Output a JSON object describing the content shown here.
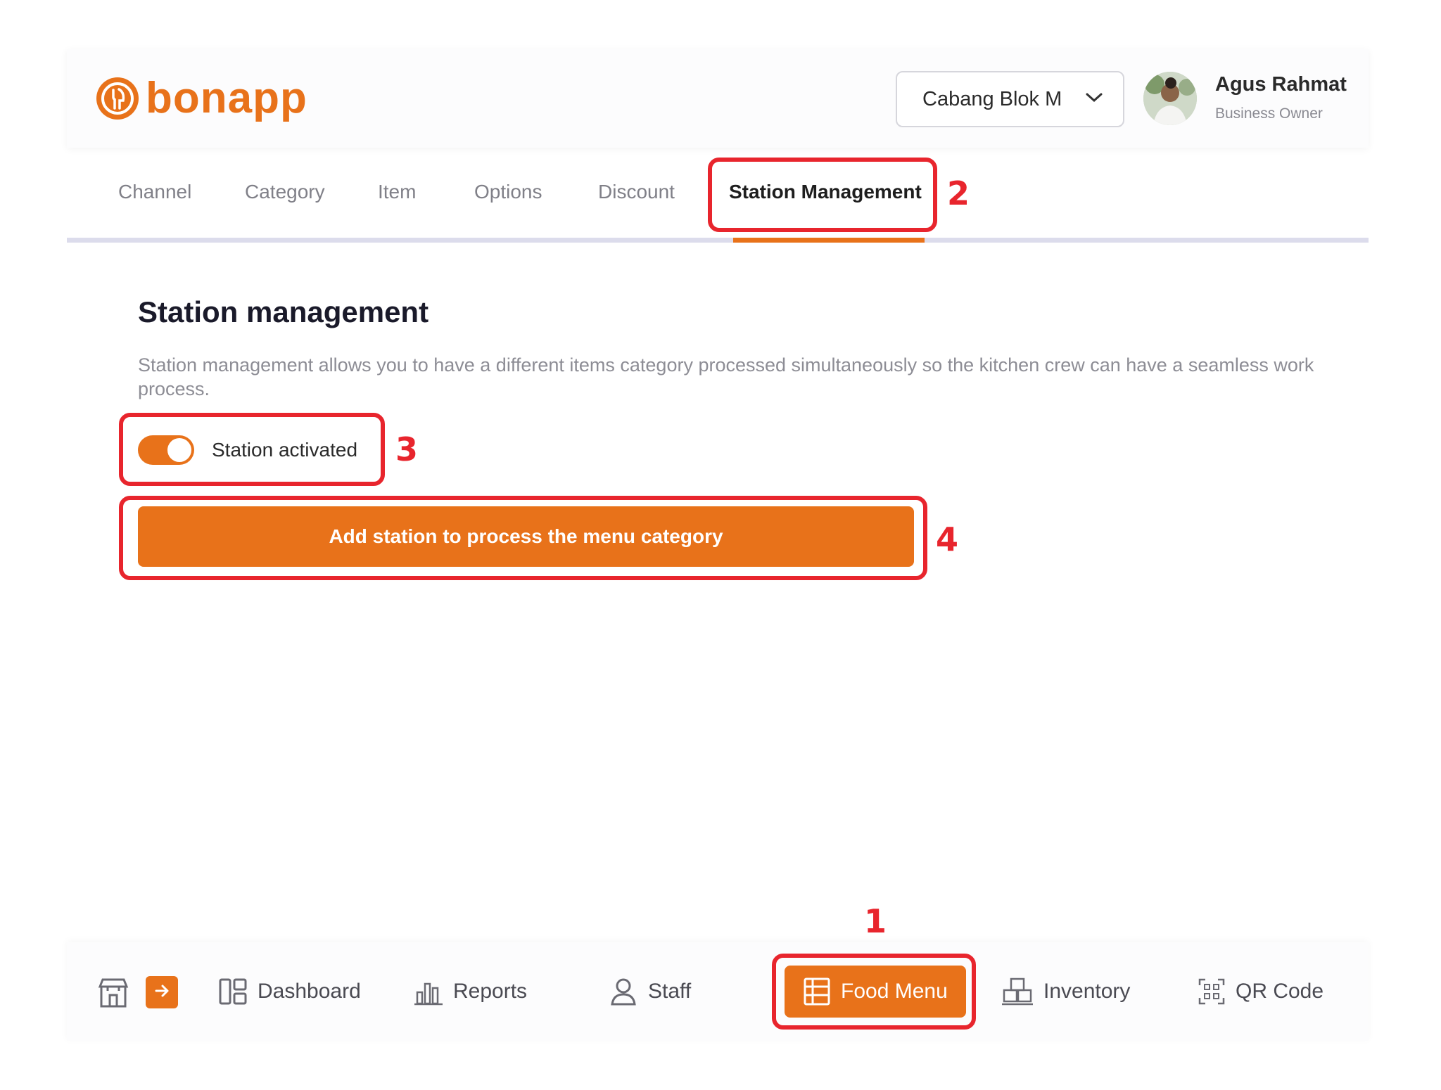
{
  "brand": {
    "name": "bonapp",
    "color": "#e8721a"
  },
  "header": {
    "branch": {
      "label": "Cabang Blok M",
      "icon": "chevron-down-icon"
    },
    "user": {
      "name": "Agus Rahmat",
      "role": "Business Owner"
    }
  },
  "tabs": [
    {
      "label": "Channel",
      "active": false
    },
    {
      "label": "Category",
      "active": false
    },
    {
      "label": "Item",
      "active": false
    },
    {
      "label": "Options",
      "active": false
    },
    {
      "label": "Discount",
      "active": false
    },
    {
      "label": "Station Management",
      "active": true
    }
  ],
  "main": {
    "title": "Station management",
    "description": "Station management allows you to have a different items category processed simultaneously so the kitchen crew can have a seamless work process.",
    "toggle": {
      "label": "Station activated",
      "on": true
    },
    "add_button": "Add station to process the menu category"
  },
  "annotations": {
    "food_menu": "1",
    "station_tab": "2",
    "toggle": "3",
    "add_button": "4",
    "color": "#e8252d"
  },
  "bottom_nav": {
    "items": [
      {
        "label": "Dashboard",
        "icon": "dashboard-icon"
      },
      {
        "label": "Reports",
        "icon": "bar-chart-icon"
      },
      {
        "label": "Staff",
        "icon": "user-icon"
      },
      {
        "label": "Food Menu",
        "icon": "menu-icon",
        "active": true
      },
      {
        "label": "Inventory",
        "icon": "boxes-icon"
      },
      {
        "label": "QR Code",
        "icon": "qr-code-icon"
      }
    ]
  }
}
